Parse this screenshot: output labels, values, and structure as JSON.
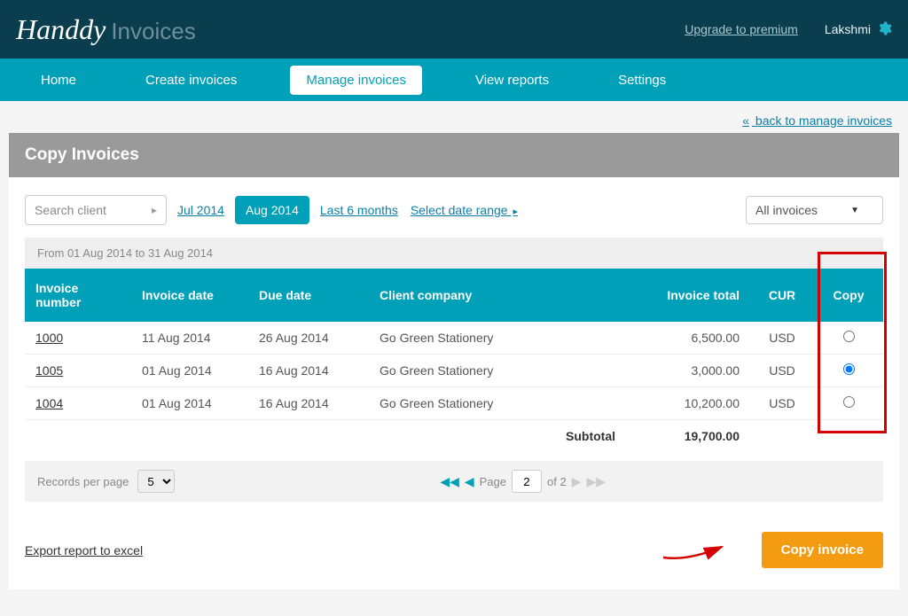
{
  "top": {
    "logo_brand": "Handdy",
    "logo_product": "Invoices",
    "upgrade": "Upgrade to premium",
    "user": "Lakshmi"
  },
  "nav": {
    "items": [
      "Home",
      "Create invoices",
      "Manage invoices",
      "View reports",
      "Settings"
    ],
    "active_index": 2
  },
  "back_link": "back to manage invoices",
  "panel_title": "Copy Invoices",
  "filters": {
    "search_placeholder": "Search client",
    "prev_month": "Jul 2014",
    "cur_month": "Aug 2014",
    "last6": "Last 6 months",
    "select_range": "Select date range",
    "all_invoices": "All invoices",
    "range_text": "From 01 Aug 2014 to 31 Aug 2014"
  },
  "table": {
    "headers": {
      "invoice_number": "Invoice number",
      "invoice_date": "Invoice date",
      "due_date": "Due date",
      "client": "Client company",
      "total": "Invoice total",
      "cur": "CUR",
      "copy": "Copy"
    },
    "rows": [
      {
        "num": "1000",
        "date": "11 Aug 2014",
        "due": "26 Aug 2014",
        "client": "Go Green Stationery",
        "total": "6,500.00",
        "cur": "USD",
        "selected": false
      },
      {
        "num": "1005",
        "date": "01 Aug 2014",
        "due": "16 Aug 2014",
        "client": "Go Green Stationery",
        "total": "3,000.00",
        "cur": "USD",
        "selected": true
      },
      {
        "num": "1004",
        "date": "01 Aug 2014",
        "due": "16 Aug 2014",
        "client": "Go Green Stationery",
        "total": "10,200.00",
        "cur": "USD",
        "selected": false
      }
    ],
    "subtotal_label": "Subtotal",
    "subtotal_value": "19,700.00"
  },
  "pager": {
    "rpp_label": "Records per page",
    "rpp_value": "5",
    "page_label": "Page",
    "page_value": "2",
    "of_label": "of 2"
  },
  "export_label": "Export report to excel",
  "copy_button": "Copy invoice"
}
